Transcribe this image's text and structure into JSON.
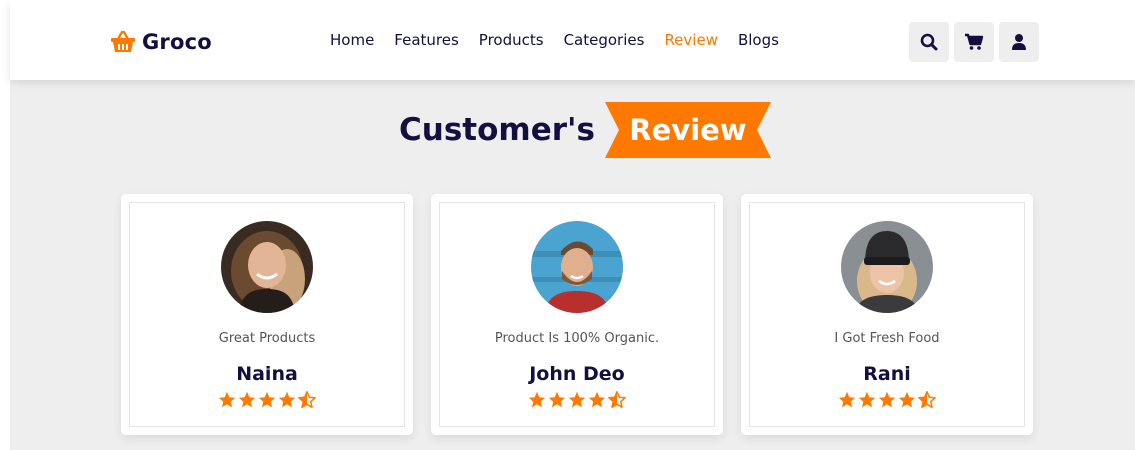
{
  "brand": {
    "name": "Groco",
    "icon": "basket-icon",
    "accent_color": "#ff7800",
    "text_color": "#130f40"
  },
  "nav": {
    "items": [
      {
        "label": "Home"
      },
      {
        "label": "Features"
      },
      {
        "label": "Products"
      },
      {
        "label": "Categories"
      },
      {
        "label": "Review",
        "active": true
      },
      {
        "label": "Blogs"
      }
    ]
  },
  "header_icons": [
    "search-icon",
    "cart-icon",
    "user-icon"
  ],
  "reviews_section": {
    "heading_main": "Customer's",
    "heading_accent": "Review",
    "cards": [
      {
        "text": "Great Products",
        "name": "Naina",
        "rating": 4.5
      },
      {
        "text": "Product Is 100% Organic.",
        "name": "John Deo",
        "rating": 4.5
      },
      {
        "text": "I Got Fresh Food",
        "name": "Rani",
        "rating": 4.5
      }
    ]
  }
}
